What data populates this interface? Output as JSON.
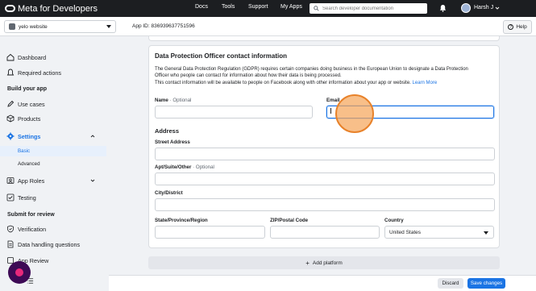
{
  "topbar": {
    "brand": "Meta for Developers",
    "nav": [
      "Docs",
      "Tools",
      "Support",
      "My Apps"
    ],
    "search_placeholder": "Search developer documentation",
    "user_name": "Harsh J"
  },
  "appbar": {
    "app_name": "yelo website",
    "app_id": "App ID: 836939637751596",
    "help_label": "Help"
  },
  "sidebar": {
    "items": [
      {
        "label": "Dashboard",
        "icon": "house-icon"
      },
      {
        "label": "Required actions",
        "icon": "bell-icon"
      }
    ],
    "section_build": "Build your app",
    "build_items": [
      {
        "label": "Use cases",
        "icon": "pencil-icon"
      },
      {
        "label": "Products",
        "icon": "cube-icon"
      }
    ],
    "settings_label": "Settings",
    "settings_sub": [
      "Basic",
      "Advanced"
    ],
    "app_roles_label": "App Roles",
    "testing_label": "Testing",
    "section_review": "Submit for review",
    "review_items": [
      {
        "label": "Verification",
        "icon": "shield-check-icon"
      },
      {
        "label": "Data handling questions",
        "icon": "file-icon"
      },
      {
        "label": "App Review",
        "icon": "review-icon"
      }
    ]
  },
  "dpo": {
    "title": "Data Protection Officer contact information",
    "desc_line1": "The General Data Protection Regulation (GDPR) requires certain companies doing business in the European Union to designate a Data Protection",
    "desc_line2": "Officer who people can contact for information about how their data is being processed.",
    "desc_line3": "This contact information will be available to people on Facebook along with other information about your app or website.",
    "learn_more": "Learn More",
    "name_label": "Name",
    "optional": " · Optional",
    "email_label": "Email",
    "address_head": "Address",
    "street_label": "Street Address",
    "apt_label": "Apt/Suite/Other",
    "city_label": "City/District",
    "state_label": "State/Province/Region",
    "zip_label": "ZIP/Postal Code",
    "country_label": "Country",
    "country_value": "United States",
    "values": {
      "name": "",
      "email": "",
      "street": "",
      "apt": "",
      "city": "",
      "state": "",
      "zip": ""
    }
  },
  "add_platform": "Add platform",
  "footer": {
    "discard": "Discard",
    "save": "Save changes"
  },
  "colors": {
    "accent": "#1b74e4",
    "topbar": "#1c1e21",
    "click_marker": "#f5a65c"
  }
}
